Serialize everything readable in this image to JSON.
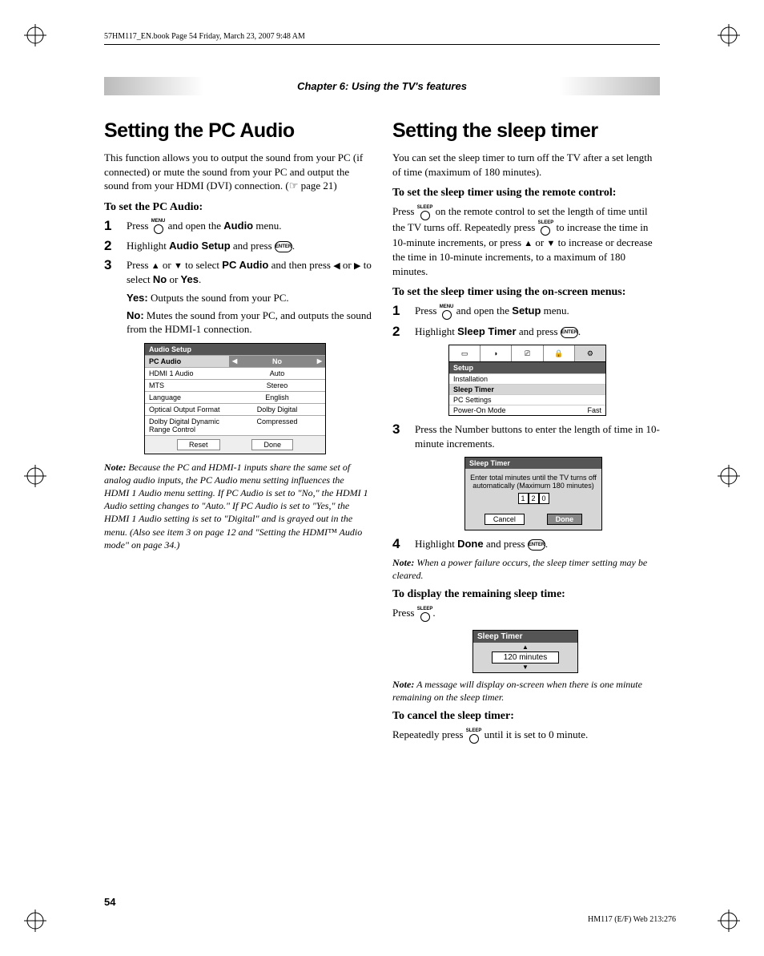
{
  "header_line": "57HM117_EN.book  Page 54  Friday, March 23, 2007  9:48 AM",
  "chapter": "Chapter 6: Using the TV's features",
  "page_number": "54",
  "footer_code": "HM117 (E/F) Web 213:276",
  "left": {
    "title": "Setting the PC Audio",
    "intro": "This function allows you to output the sound from your PC (if connected) or mute the sound from your PC and output the sound from your HDMI (DVI) connection. (☞ page 21)",
    "sub1": "To set the PC Audio:",
    "step1_a": "Press ",
    "step1_menu": "MENU",
    "step1_b": " and open the ",
    "step1_audio": "Audio",
    "step1_c": " menu.",
    "step2_a": "Highlight ",
    "step2_b": "Audio Setup",
    "step2_c": " and press ",
    "step2_enter": "ENTER",
    "step2_d": ".",
    "step3_a": "Press ",
    "step3_b": " or ",
    "step3_c": " to select ",
    "step3_pc": "PC Audio",
    "step3_d": " and then press ",
    "step3_e": " or ",
    "step3_f": " to select ",
    "step3_no": "No",
    "step3_or": " or ",
    "step3_yes": "Yes",
    "step3_g": ".",
    "yes_label": "Yes:",
    "yes_text": " Outputs the sound from your PC.",
    "no_label": "No:",
    "no_text": " Mutes the sound from your PC, and outputs the sound from the HDMI-1 connection.",
    "ui": {
      "title": "Audio Setup",
      "r1l": "PC Audio",
      "r1r": "No",
      "r2l": "HDMI 1 Audio",
      "r2r": "Auto",
      "r3l": "MTS",
      "r3r": "Stereo",
      "r4l": "Language",
      "r4r": "English",
      "r5l": "Optical Output Format",
      "r5r": "Dolby Digital",
      "r6l": "Dolby Digital Dynamic Range Control",
      "r6r": "Compressed",
      "btn1": "Reset",
      "btn2": "Done"
    },
    "note_label": "Note:",
    "note": " Because the PC and HDMI-1 inputs share the same set of analog audio inputs, the PC Audio menu setting influences the HDMI 1 Audio menu setting. If PC Audio is set to \"No,\" the HDMI 1 Audio setting changes to \"Auto.\" If PC Audio is set to \"Yes,\" the HDMI 1 Audio setting is set to \"Digital\" and is grayed out in the menu. (Also see item 3 on page 12 and \"Setting the HDMI™ Audio mode\" on page 34.)"
  },
  "right": {
    "title": "Setting the sleep timer",
    "intro": "You can set the sleep timer to turn off the TV after a set length of time (maximum of 180 minutes).",
    "sub1": "To set the sleep timer using the remote control:",
    "p1_a": "Press ",
    "p1_sleep": "SLEEP",
    "p1_b": " on the remote control to set the length of time until the TV turns off. Repeatedly press ",
    "p1_c": " to increase the time in 10-minute increments, or press ",
    "p1_d": " or ",
    "p1_e": " to increase or decrease the time in 10-minute increments, to a maximum of 180 minutes.",
    "sub2": "To set the sleep timer using the on-screen menus:",
    "step1_a": "Press ",
    "step1_menu": "MENU",
    "step1_b": " and open the ",
    "step1_setup": "Setup",
    "step1_c": " menu.",
    "step2_a": "Highlight ",
    "step2_b": "Sleep Timer",
    "step2_c": " and press ",
    "step2_enter": "ENTER",
    "step2_d": ".",
    "setup": {
      "hdr": "Setup",
      "r1": "Installation",
      "r2": "Sleep Timer",
      "r3": "PC Settings",
      "r4l": "Power-On Mode",
      "r4r": "Fast"
    },
    "step3": "Press the Number buttons to enter the length of time in 10-minute increments.",
    "sleep": {
      "title": "Sleep Timer",
      "msg": "Enter total minutes until the TV turns off automatically (Maximum 180 minutes)",
      "d1": "1",
      "d2": "2",
      "d3": "0",
      "cancel": "Cancel",
      "done": "Done"
    },
    "step4_a": "Highlight ",
    "step4_b": "Done",
    "step4_c": " and press ",
    "step4_enter": "ENTER",
    "step4_d": ".",
    "note1_label": "Note:",
    "note1": " When a power failure occurs, the sleep timer setting may be cleared.",
    "sub3": "To display the remaining sleep time:",
    "p3_a": "Press ",
    "p3_b": ".",
    "remain": {
      "title": "Sleep Timer",
      "value": "120 minutes"
    },
    "note2_label": "Note:",
    "note2": " A message will display on-screen when there is one minute remaining on the sleep timer.",
    "sub4": "To cancel the sleep timer:",
    "p4_a": "Repeatedly press ",
    "p4_b": " until it is set to 0 minute."
  }
}
